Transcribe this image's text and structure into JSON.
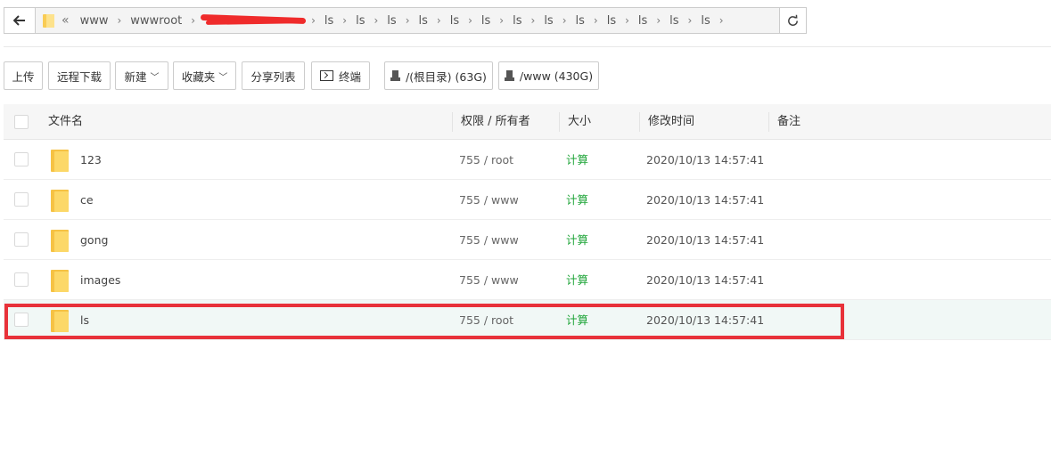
{
  "pathbar": {
    "crumbs_before": [
      "www",
      "wwwroot"
    ],
    "crumbs_after": [
      "ls",
      "ls",
      "ls",
      "ls",
      "ls",
      "ls",
      "ls",
      "ls",
      "ls",
      "ls",
      "ls",
      "ls",
      "ls"
    ]
  },
  "toolbar": {
    "upload": "上传",
    "remote_download": "远程下载",
    "new": "新建",
    "favorites": "收藏夹",
    "share_list": "分享列表",
    "terminal": "终端",
    "disk_root": "/(根目录) (63G)",
    "disk_www": "/www (430G)"
  },
  "table": {
    "headers": {
      "filename": "文件名",
      "permission": "权限 / 所有者",
      "size": "大小",
      "modified": "修改时间",
      "note": "备注"
    },
    "rows": [
      {
        "name": "123",
        "perm": "755 / root",
        "size": "计算",
        "time": "2020/10/13 14:57:41"
      },
      {
        "name": "ce",
        "perm": "755 / www",
        "size": "计算",
        "time": "2020/10/13 14:57:41"
      },
      {
        "name": "gong",
        "perm": "755 / www",
        "size": "计算",
        "time": "2020/10/13 14:57:41"
      },
      {
        "name": "images",
        "perm": "755 / www",
        "size": "计算",
        "time": "2020/10/13 14:57:41"
      },
      {
        "name": "ls",
        "perm": "755 / root",
        "size": "计算",
        "time": "2020/10/13 14:57:41"
      }
    ]
  },
  "colors": {
    "size_link": "#20a53a",
    "highlight_border": "#e8323a",
    "selected_row": "#f1f8f6",
    "folder": "#f6c244"
  }
}
